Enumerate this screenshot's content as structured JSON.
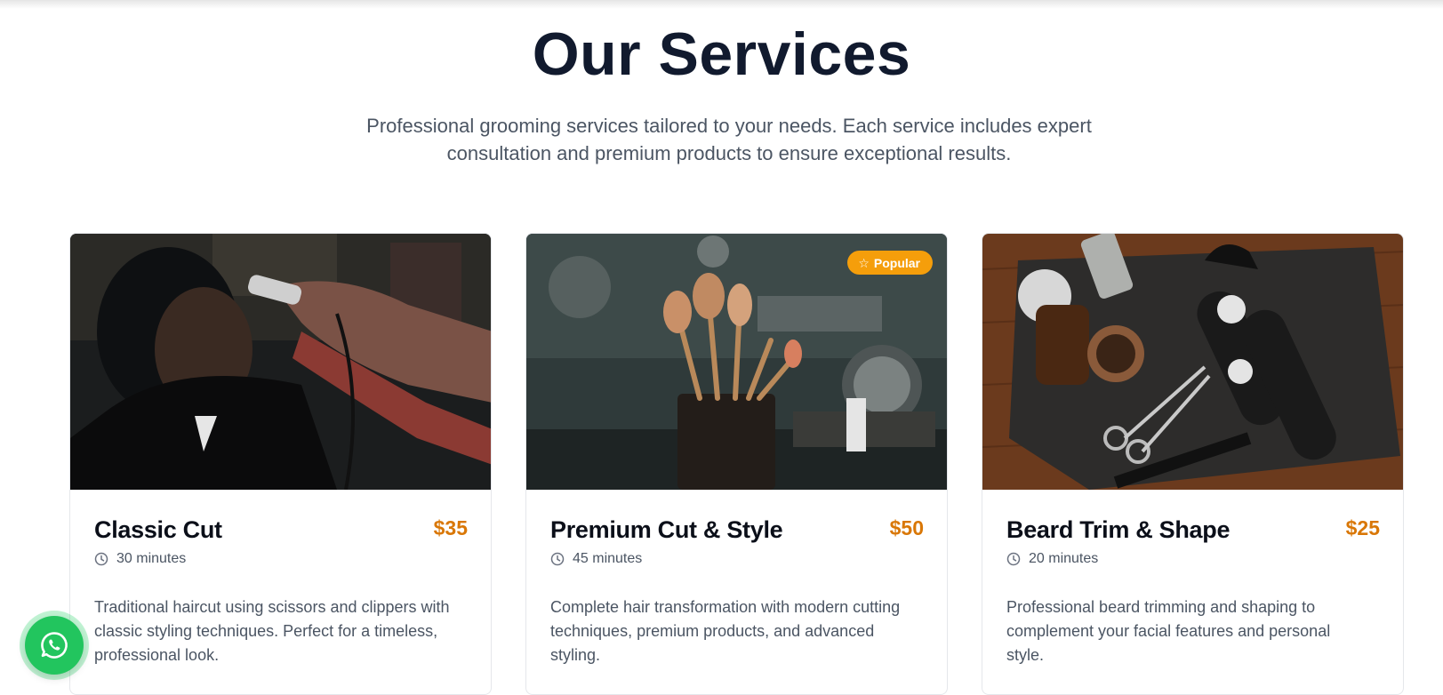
{
  "section": {
    "title": "Our Services",
    "subtitle": "Professional grooming services tailored to your needs. Each service includes expert consultation and premium products to ensure exceptional results."
  },
  "services": [
    {
      "name": "Classic Cut",
      "price": "$35",
      "duration": "30 minutes",
      "description": "Traditional haircut using scissors and clippers with classic styling techniques. Perfect for a timeless, professional look.",
      "image": "barber-cutting-hair-photo"
    },
    {
      "name": "Premium Cut & Style",
      "price": "$50",
      "duration": "45 minutes",
      "description": "Complete hair transformation with modern cutting techniques, premium products, and advanced styling.",
      "badge": "Popular",
      "image": "makeup-brushes-photo"
    },
    {
      "name": "Beard Trim & Shape",
      "price": "$25",
      "duration": "20 minutes",
      "description": "Professional beard trimming and shaping to complement your facial features and personal style.",
      "image": "barber-tools-flatlay-photo"
    }
  ],
  "colors": {
    "title": "#111a2e",
    "price_accent": "#d97706",
    "badge": "#f59e0b",
    "whatsapp": "#22c55e"
  },
  "icons": {
    "duration": "clock-icon",
    "badge": "star-icon",
    "floating": "whatsapp-icon"
  }
}
